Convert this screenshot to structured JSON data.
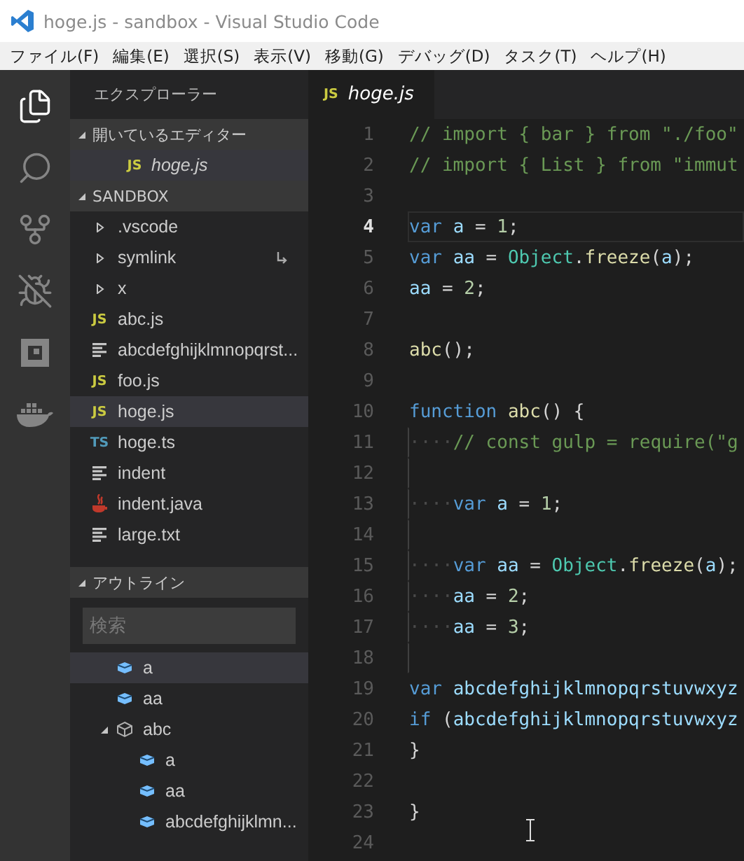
{
  "window": {
    "title": "hoge.js - sandbox - Visual Studio Code"
  },
  "menu": [
    "ファイル(F)",
    "編集(E)",
    "選択(S)",
    "表示(V)",
    "移動(G)",
    "デバッグ(D)",
    "タスク(T)",
    "ヘルプ(H)"
  ],
  "activity_bar": [
    {
      "kind": "files",
      "selected": true
    },
    {
      "kind": "search",
      "selected": false
    },
    {
      "kind": "source-control",
      "selected": false
    },
    {
      "kind": "debug",
      "selected": false
    },
    {
      "kind": "extensions",
      "selected": false
    },
    {
      "kind": "docker",
      "selected": false
    }
  ],
  "sidebar": {
    "title": "エクスプローラー",
    "open_editors": {
      "title": "開いているエディター",
      "expanded": true,
      "items": [
        {
          "name": "hoge.js",
          "badge": "JS",
          "kind": "js",
          "preview": true,
          "selected": false
        }
      ]
    },
    "folder": {
      "title": "SANDBOX",
      "expanded": true,
      "items": [
        {
          "name": ".vscode",
          "kind": "folder",
          "expanded": false,
          "selected": false
        },
        {
          "name": "symlink",
          "kind": "folder",
          "expanded": false,
          "symlink": true,
          "selected": false
        },
        {
          "name": "x",
          "kind": "folder",
          "expanded": false,
          "selected": false
        },
        {
          "name": "abc.js",
          "kind": "js",
          "badge": "JS",
          "selected": false
        },
        {
          "name": "abcdefghijklmnopqrst...",
          "kind": "text",
          "selected": false
        },
        {
          "name": "foo.js",
          "kind": "js",
          "badge": "JS",
          "selected": false
        },
        {
          "name": "hoge.js",
          "kind": "js",
          "badge": "JS",
          "selected": true
        },
        {
          "name": "hoge.ts",
          "kind": "ts",
          "badge": "TS",
          "selected": false
        },
        {
          "name": "indent",
          "kind": "text",
          "selected": false
        },
        {
          "name": "indent.java",
          "kind": "java",
          "selected": false
        },
        {
          "name": "large.txt",
          "kind": "text",
          "selected": false
        }
      ]
    },
    "outline": {
      "title": "アウトライン",
      "expanded": true,
      "search": {
        "placeholder": "検索"
      },
      "items": [
        {
          "name": "a",
          "kind": "variable",
          "selected": true
        },
        {
          "name": "aa",
          "kind": "variable",
          "selected": false
        },
        {
          "name": "abc",
          "kind": "class",
          "expanded": true,
          "selected": false,
          "children": [
            {
              "name": "a",
              "kind": "variable",
              "selected": false
            },
            {
              "name": "aa",
              "kind": "variable",
              "selected": false
            },
            {
              "name": "abcdefghijklmn...",
              "kind": "variable",
              "selected": false
            }
          ]
        }
      ]
    }
  },
  "editor": {
    "tabs": [
      {
        "label": "hoge.js",
        "badge": "JS",
        "selected": true,
        "preview": true
      }
    ],
    "lines": [
      {
        "number": "1",
        "tokens": [
          {
            "kind": "comment",
            "text": "// import { bar } from \"./foo\""
          }
        ]
      },
      {
        "number": "2",
        "tokens": [
          {
            "kind": "comment",
            "text": "// import { List } from \"immut"
          }
        ]
      },
      {
        "number": "3"
      },
      {
        "number": "4",
        "current": true,
        "tokens": [
          {
            "kind": "keyword",
            "text": "var "
          },
          {
            "kind": "variable",
            "text": "a"
          },
          {
            "kind": "plain",
            "text": " = "
          },
          {
            "kind": "number",
            "text": "1"
          },
          {
            "kind": "plain",
            "text": ";"
          }
        ]
      },
      {
        "number": "5",
        "tokens": [
          {
            "kind": "keyword",
            "text": "var "
          },
          {
            "kind": "variable",
            "text": "aa"
          },
          {
            "kind": "plain",
            "text": " = "
          },
          {
            "kind": "type",
            "text": "Object"
          },
          {
            "kind": "plain",
            "text": "."
          },
          {
            "kind": "function",
            "text": "freeze"
          },
          {
            "kind": "plain",
            "text": "("
          },
          {
            "kind": "variable",
            "text": "a"
          },
          {
            "kind": "plain",
            "text": ");"
          }
        ]
      },
      {
        "number": "6",
        "tokens": [
          {
            "kind": "variable",
            "text": "aa"
          },
          {
            "kind": "plain",
            "text": " = "
          },
          {
            "kind": "number",
            "text": "2"
          },
          {
            "kind": "plain",
            "text": ";"
          }
        ]
      },
      {
        "number": "7"
      },
      {
        "number": "8",
        "tokens": [
          {
            "kind": "function",
            "text": "abc"
          },
          {
            "kind": "plain",
            "text": "();"
          }
        ]
      },
      {
        "number": "9"
      },
      {
        "number": "10",
        "tokens": [
          {
            "kind": "keyword",
            "text": "function "
          },
          {
            "kind": "function",
            "text": "abc"
          },
          {
            "kind": "plain",
            "text": "() {"
          }
        ]
      },
      {
        "number": "11",
        "guide": true,
        "tokens": [
          {
            "kind": "whitespace",
            "text": "····"
          },
          {
            "kind": "comment",
            "text": "// const gulp = require(\"g"
          }
        ]
      },
      {
        "number": "12",
        "guide": true
      },
      {
        "number": "13",
        "guide": true,
        "tokens": [
          {
            "kind": "whitespace",
            "text": "····"
          },
          {
            "kind": "keyword",
            "text": "var "
          },
          {
            "kind": "variable",
            "text": "a"
          },
          {
            "kind": "plain",
            "text": " = "
          },
          {
            "kind": "number",
            "text": "1"
          },
          {
            "kind": "plain",
            "text": ";"
          }
        ]
      },
      {
        "number": "14",
        "guide": true
      },
      {
        "number": "15",
        "guide": true,
        "tokens": [
          {
            "kind": "whitespace",
            "text": "····"
          },
          {
            "kind": "keyword",
            "text": "var "
          },
          {
            "kind": "variable",
            "text": "aa"
          },
          {
            "kind": "plain",
            "text": " = "
          },
          {
            "kind": "type",
            "text": "Object"
          },
          {
            "kind": "plain",
            "text": "."
          },
          {
            "kind": "function",
            "text": "freeze"
          },
          {
            "kind": "plain",
            "text": "("
          },
          {
            "kind": "variable",
            "text": "a"
          },
          {
            "kind": "plain",
            "text": ");"
          }
        ]
      },
      {
        "number": "16",
        "guide": true,
        "tokens": [
          {
            "kind": "whitespace",
            "text": "····"
          },
          {
            "kind": "variable",
            "text": "aa"
          },
          {
            "kind": "plain",
            "text": " = "
          },
          {
            "kind": "number",
            "text": "2"
          },
          {
            "kind": "plain",
            "text": ";"
          }
        ]
      },
      {
        "number": "17",
        "guide": true,
        "tokens": [
          {
            "kind": "whitespace",
            "text": "····"
          },
          {
            "kind": "variable",
            "text": "aa"
          },
          {
            "kind": "plain",
            "text": " = "
          },
          {
            "kind": "number",
            "text": "3"
          },
          {
            "kind": "plain",
            "text": ";"
          }
        ]
      },
      {
        "number": "18",
        "guide": true
      },
      {
        "number": "19",
        "tokens": [
          {
            "kind": "keyword",
            "text": "var "
          },
          {
            "kind": "variable",
            "text": "abcdefghijklmnopqrstuvwxyz"
          }
        ]
      },
      {
        "number": "20",
        "tokens": [
          {
            "kind": "keyword",
            "text": "if"
          },
          {
            "kind": "plain",
            "text": " ("
          },
          {
            "kind": "variable",
            "text": "abcdefghijklmnopqrstuvwxyz"
          }
        ]
      },
      {
        "number": "21",
        "tokens": [
          {
            "kind": "plain",
            "text": "}"
          }
        ]
      },
      {
        "number": "22"
      },
      {
        "number": "23",
        "tokens": [
          {
            "kind": "plain",
            "text": "}"
          }
        ]
      },
      {
        "number": "24"
      }
    ]
  }
}
